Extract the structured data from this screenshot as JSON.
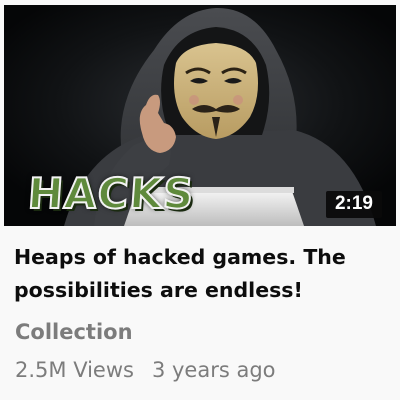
{
  "video": {
    "thumbnail_text": "HACKS",
    "duration": "2:19",
    "title": "Heaps of hacked games. The possibilities are endless!",
    "channel": "Collection",
    "views": "2.5M Views",
    "age": "3 years ago"
  },
  "colors": {
    "background": "#f9f9f9",
    "title": "#0d0d0d",
    "meta": "#7c7c7c",
    "badge_bg": "#0a0a0a",
    "hacks_green": "#5f8a3c"
  }
}
